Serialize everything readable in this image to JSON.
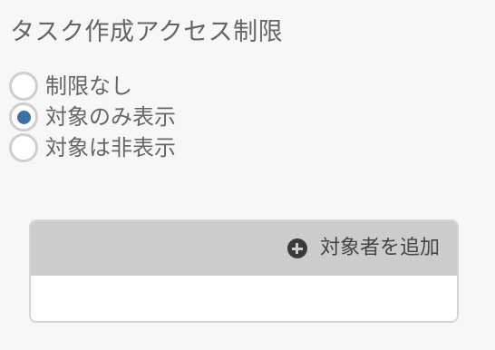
{
  "title": "タスク作成アクセス制限",
  "access_options": [
    {
      "label": "制限なし",
      "checked": false
    },
    {
      "label": "対象のみ表示",
      "checked": true
    },
    {
      "label": "対象は非表示",
      "checked": false
    }
  ],
  "targets_panel": {
    "add_label": "対象者を追加",
    "add_icon": "plus-circle-icon"
  },
  "colors": {
    "accent": "#3e6fa8",
    "panel_header": "#cccccc",
    "background": "#f7f7f7"
  }
}
